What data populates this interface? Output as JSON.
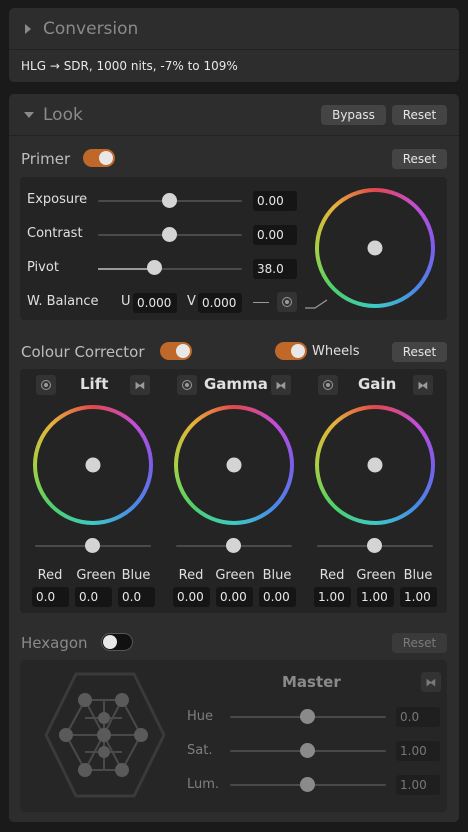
{
  "conversion": {
    "title": "Conversion",
    "summary": "HLG → SDR, 1000 nits, -7% to 109%"
  },
  "look": {
    "title": "Look",
    "bypass_label": "Bypass",
    "reset_label": "Reset"
  },
  "primer": {
    "title": "Primer",
    "enabled": true,
    "reset_label": "Reset",
    "exposure": {
      "label": "Exposure",
      "value": "0.00",
      "level": 0.5
    },
    "contrast": {
      "label": "Contrast",
      "value": "0.00",
      "level": 0.5
    },
    "pivot": {
      "label": "Pivot",
      "value": "38.0",
      "level": 0.39
    },
    "white_balance": {
      "label": "W. Balance",
      "u_label": "U",
      "u_value": "0.000",
      "v_label": "V",
      "v_value": "0.000"
    }
  },
  "colour_corrector": {
    "title": "Colour Corrector",
    "enabled": true,
    "wheels_label": "Wheels",
    "wheels_enabled": true,
    "reset_label": "Reset",
    "channel_labels": [
      "Red",
      "Green",
      "Blue"
    ],
    "groups": [
      {
        "name": "Lift",
        "values": [
          "0.0",
          "0.0",
          "0.0"
        ]
      },
      {
        "name": "Gamma",
        "values": [
          "0.00",
          "0.00",
          "0.00"
        ]
      },
      {
        "name": "Gain",
        "values": [
          "1.00",
          "1.00",
          "1.00"
        ]
      }
    ]
  },
  "hexagon": {
    "title": "Hexagon",
    "enabled": false,
    "reset_label": "Reset",
    "master_label": "Master",
    "hue": {
      "label": "Hue",
      "value": "0.0"
    },
    "sat": {
      "label": "Sat.",
      "value": "1.00"
    },
    "lum": {
      "label": "Lum.",
      "value": "1.00"
    }
  },
  "colors": {
    "accent": "#c0682a",
    "panel": "#2d2d2d",
    "background": "#1a1a1a"
  }
}
